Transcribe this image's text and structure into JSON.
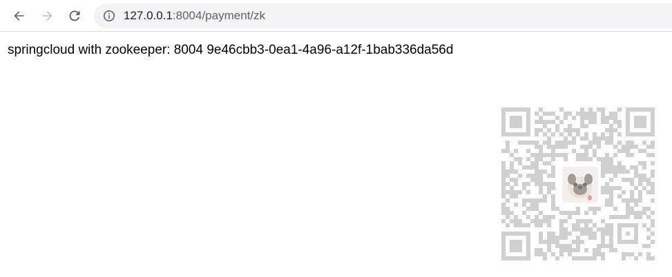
{
  "browser": {
    "url_host": "127.0.0.1",
    "url_path": ":8004/payment/zk",
    "icons": {
      "back": "arrow-left-icon",
      "forward": "arrow-right-icon",
      "reload": "reload-icon",
      "site_info": "info-icon"
    }
  },
  "page": {
    "body_text": "springcloud with zookeeper: 8004 9e46cbb3-0ea1-4a96-a12f-1bab336da56d"
  },
  "overlay": {
    "type": "qr-code",
    "color": "#b4b4b4",
    "center_image": "pug-avatar"
  },
  "colors": {
    "toolbar_bg": "#ffffff",
    "omnibox_bg": "#f1f3f4",
    "icon_gray": "#5f6368",
    "icon_disabled": "#bdc1c6"
  }
}
